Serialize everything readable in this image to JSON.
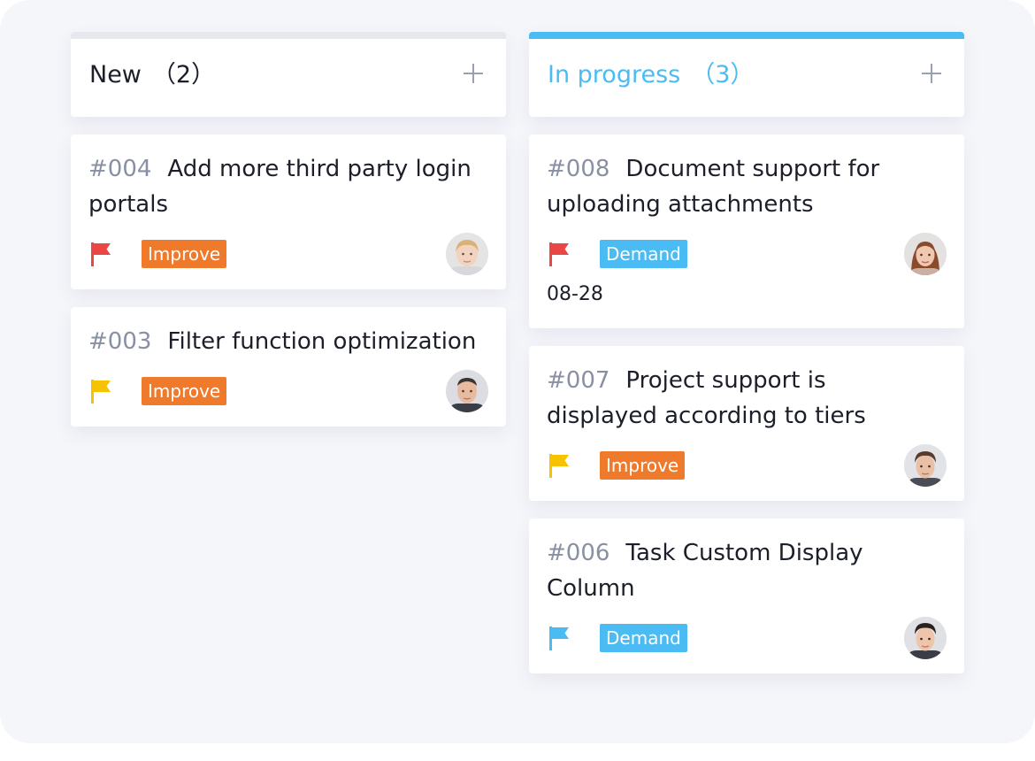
{
  "columns": [
    {
      "title": "New",
      "count": "（2）",
      "cards": [
        {
          "id": "#004",
          "title": "Add more third party login portals",
          "tag": "Improve",
          "tag_type": "improve",
          "flag_color": "#ea4646",
          "avatar": "male-blond-avatar"
        },
        {
          "id": "#003",
          "title": "Filter function optimization",
          "tag": "Improve",
          "tag_type": "improve",
          "flag_color": "#f7c200",
          "avatar": "male-bald-avatar"
        }
      ]
    },
    {
      "title": "In progress",
      "count": "（3）",
      "accent_color": "#4bbcf3",
      "cards": [
        {
          "id": "#008",
          "title": "Document support for uploading attachments",
          "tag": "Demand",
          "tag_type": "demand",
          "flag_color": "#ea4646",
          "due": "08-28",
          "avatar": "female-avatar"
        },
        {
          "id": "#007",
          "title": "Project support is displayed according to tiers",
          "tag": "Improve",
          "tag_type": "improve",
          "flag_color": "#f7c200",
          "avatar": "male-dark-hair-avatar"
        },
        {
          "id": "#006",
          "title": "Task Custom Display Column",
          "tag": "Demand",
          "tag_type": "demand",
          "flag_color": "#4bbcf3",
          "avatar": "male-short-hair-avatar"
        }
      ]
    }
  ],
  "colors": {
    "accent": "#4bbcf3",
    "improve_tag": "#f07a2b",
    "demand_tag": "#4bbcf3",
    "flag_red": "#ea4646",
    "flag_yellow": "#f7c200",
    "flag_blue": "#4bbcf3"
  },
  "icons": {
    "add": "plus-icon",
    "priority": "flag-icon"
  }
}
